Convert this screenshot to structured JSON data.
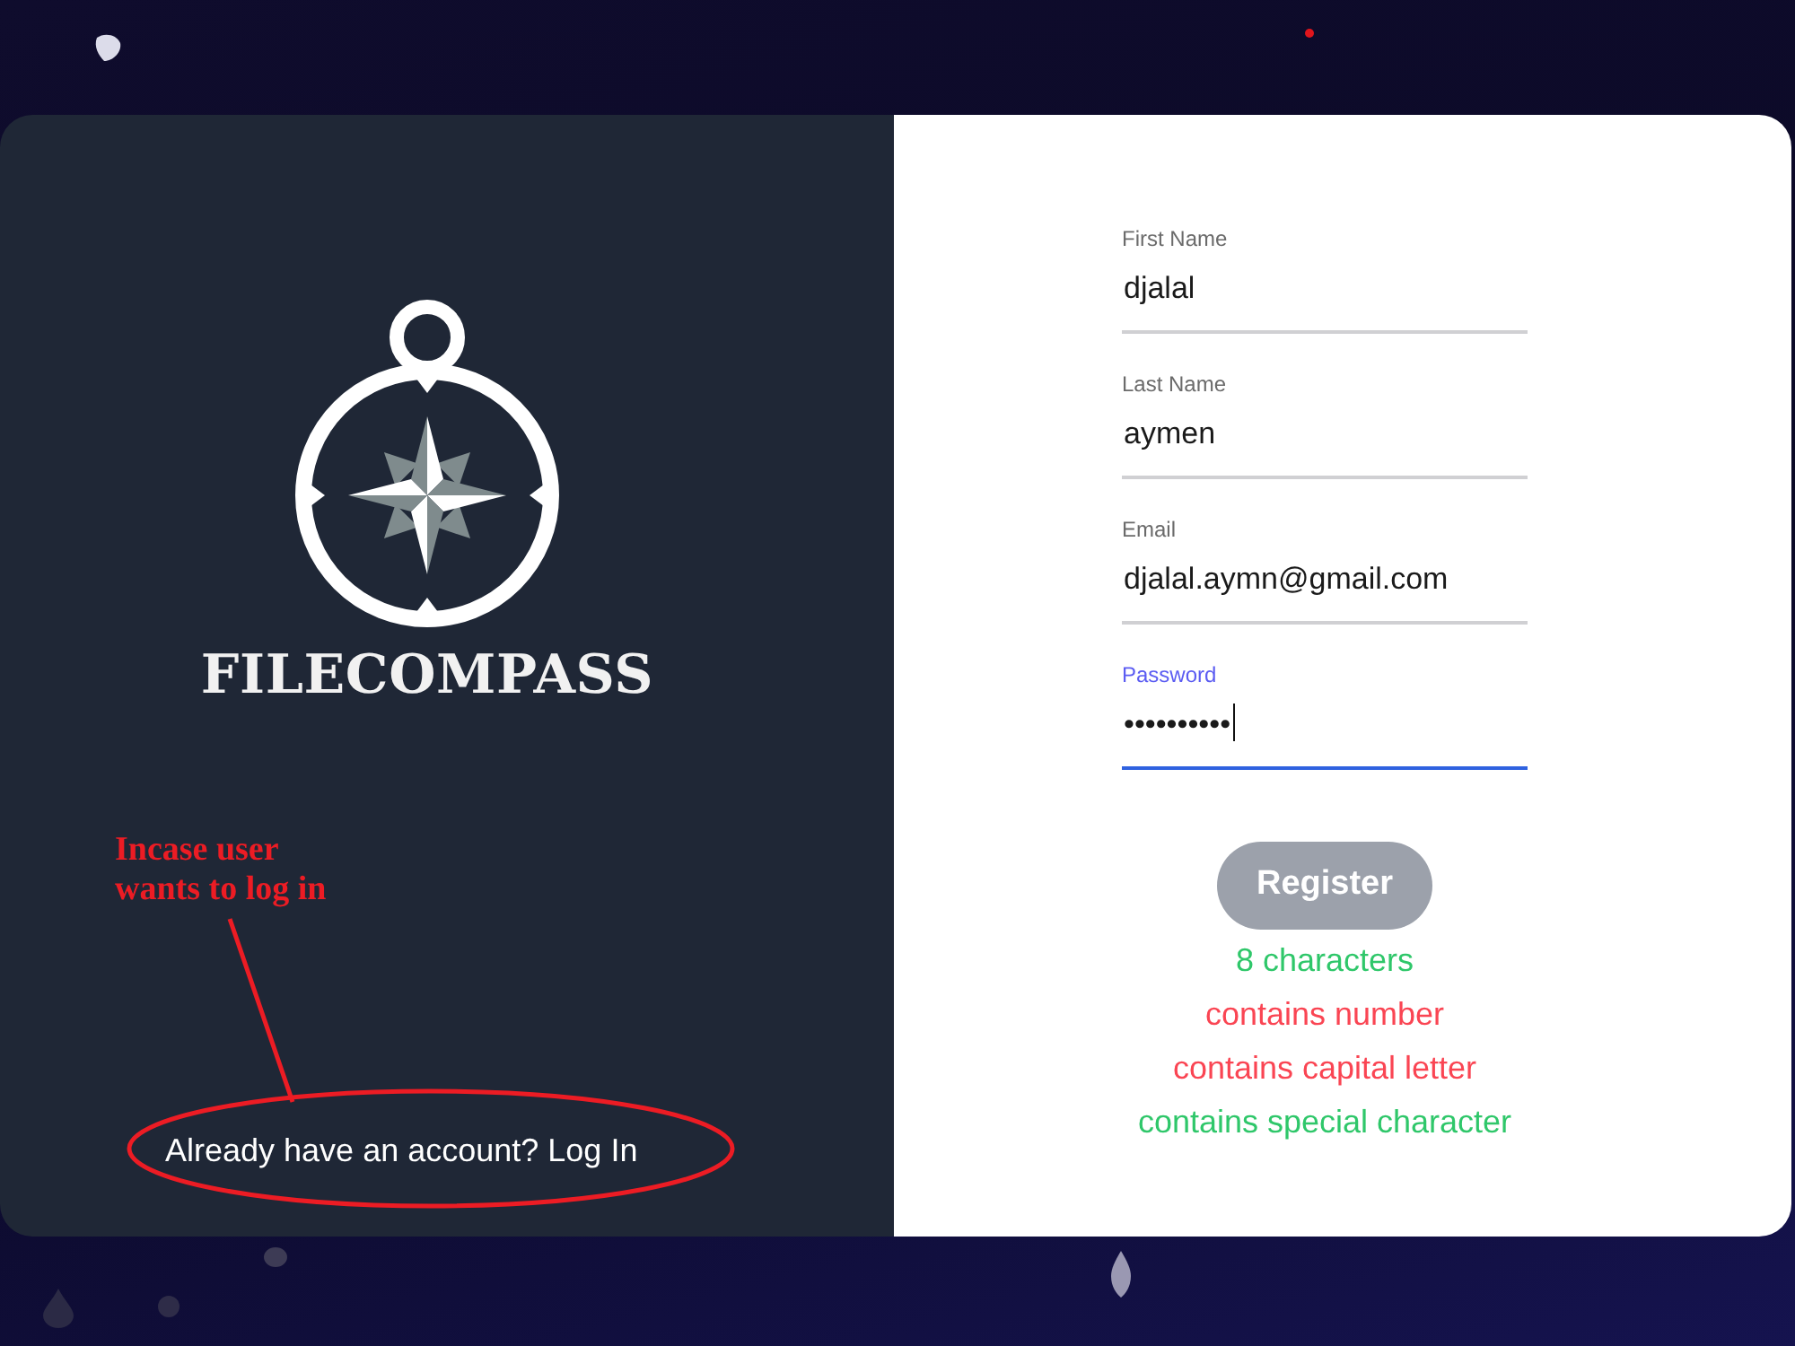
{
  "brand": {
    "name": "FILECOMPASS"
  },
  "annotation": {
    "lines": [
      "Incase user",
      "wants to log in"
    ]
  },
  "login_prompt": {
    "text": "Already have an account?",
    "link": "Log In"
  },
  "form": {
    "fields": [
      {
        "label": "First Name",
        "value": "djalal",
        "focused": false
      },
      {
        "label": "Last Name",
        "value": "aymen",
        "focused": false
      },
      {
        "label": "Email",
        "value": "djalal.aymn@gmail.com",
        "focused": false
      },
      {
        "label": "Password",
        "value": "••••••••••",
        "focused": true
      }
    ],
    "submit": {
      "label": "Register",
      "disabled": true
    },
    "password_rules": [
      {
        "text": "8 characters",
        "met": true
      },
      {
        "text": "contains number",
        "met": false
      },
      {
        "text": "contains capital letter",
        "met": false
      },
      {
        "text": "contains special character",
        "met": true
      }
    ]
  }
}
